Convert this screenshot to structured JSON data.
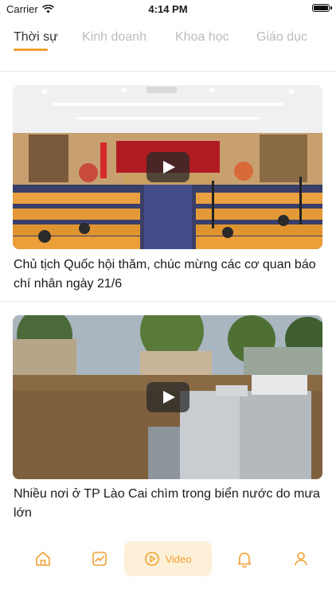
{
  "status_bar": {
    "carrier": "Carrier",
    "time": "4:14 PM"
  },
  "tabs": [
    {
      "label": "Thời sự",
      "active": true
    },
    {
      "label": "Kinh doanh",
      "active": false
    },
    {
      "label": "Khoa học",
      "active": false
    },
    {
      "label": "Giáo dục",
      "active": false
    }
  ],
  "videos": [
    {
      "title": "Chủ tịch Quốc hội thăm, chúc mừng các cơ quan báo chí nhân ngày 21/6"
    },
    {
      "title": "Nhiều nơi ở TP Lào Cai chìm trong biển nước do mưa lớn"
    }
  ],
  "bottom_nav": {
    "items": [
      "home-icon",
      "chart-icon",
      "video-icon",
      "bell-icon",
      "user-icon"
    ],
    "active_label": "Video"
  },
  "colors": {
    "accent": "#f0a030",
    "accent_bg": "#fdf0d8",
    "inactive_tab": "#bcbcbc"
  }
}
